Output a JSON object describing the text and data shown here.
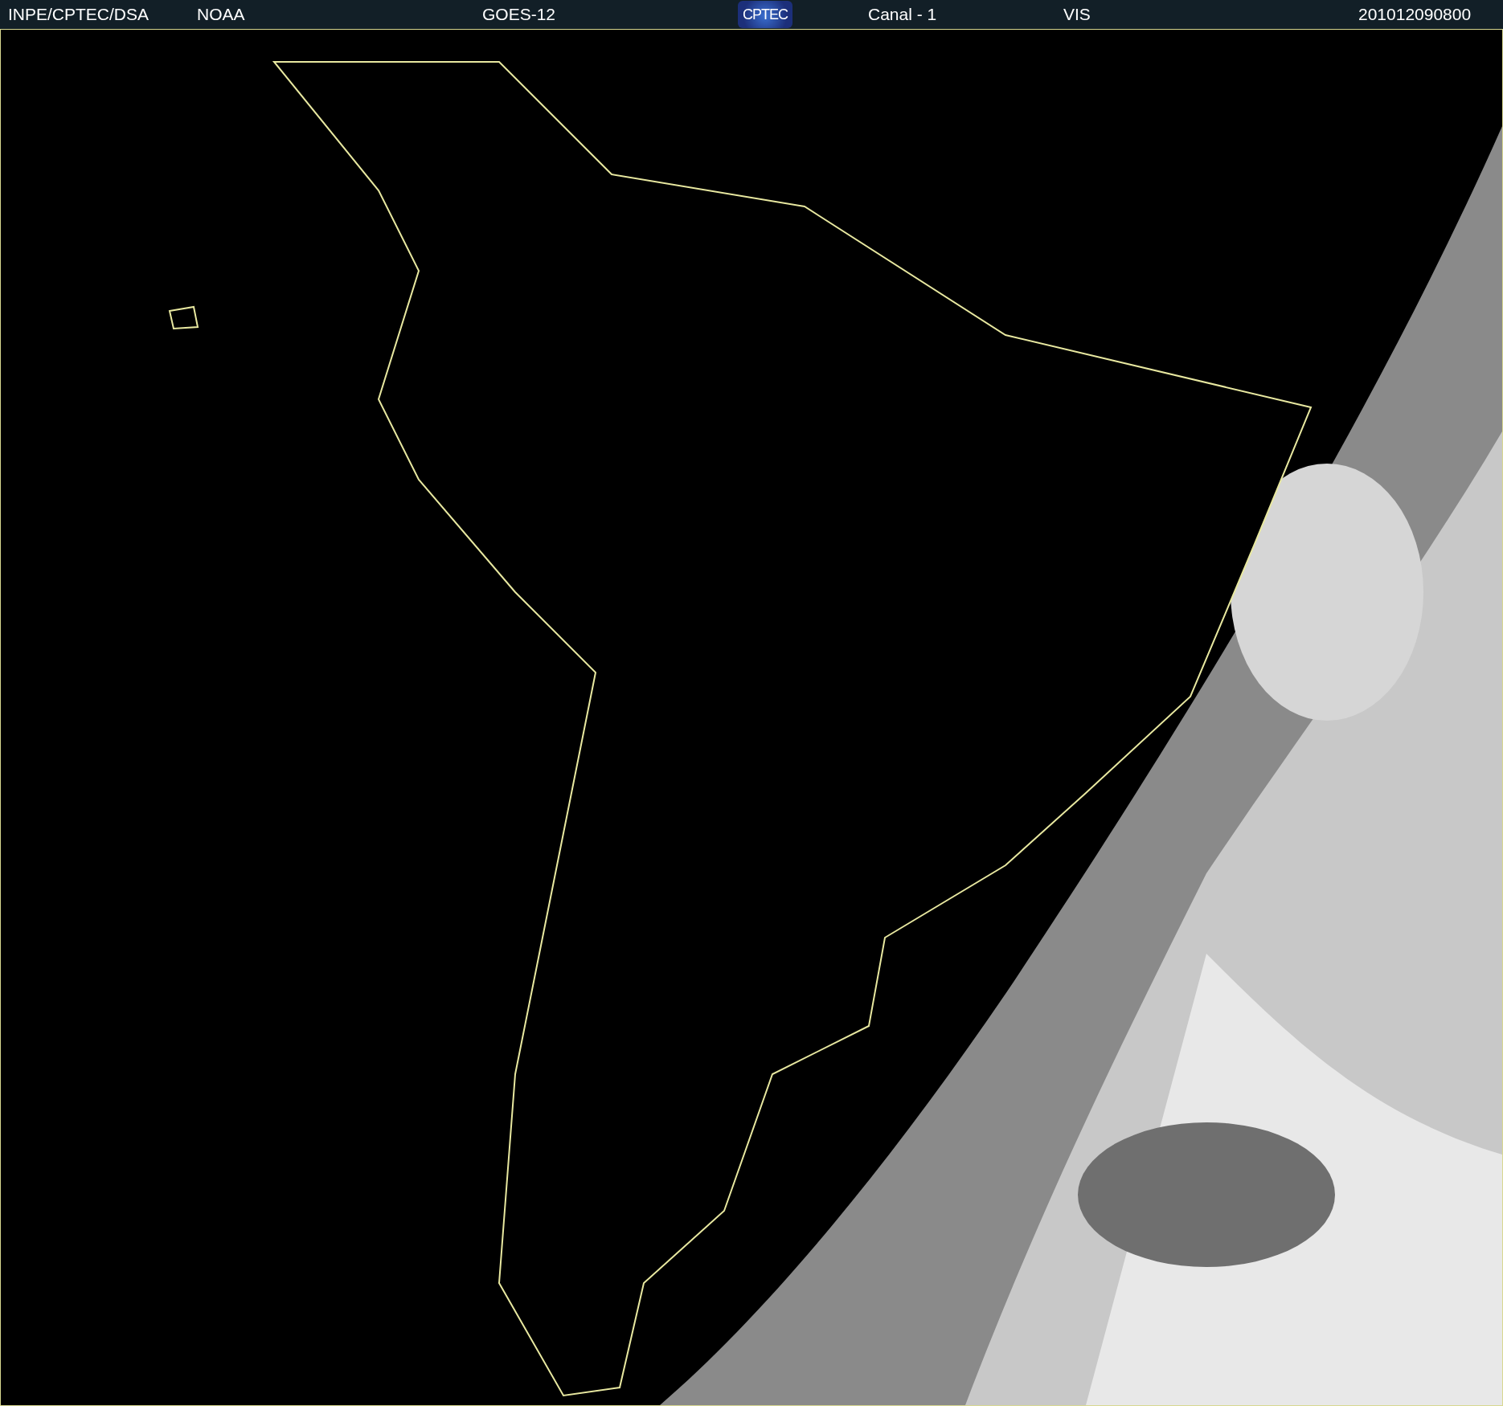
{
  "header": {
    "items": [
      {
        "kind": "text",
        "text": "INPE/CPTEC/DSA"
      },
      {
        "kind": "text",
        "text": "NOAA"
      },
      {
        "kind": "text",
        "text": "GOES-12"
      },
      {
        "kind": "logo",
        "text": "CPTEC"
      },
      {
        "kind": "text",
        "text": "Canal - 1"
      },
      {
        "kind": "text",
        "text": "VIS"
      },
      {
        "kind": "text",
        "text": "201012090800"
      }
    ]
  }
}
